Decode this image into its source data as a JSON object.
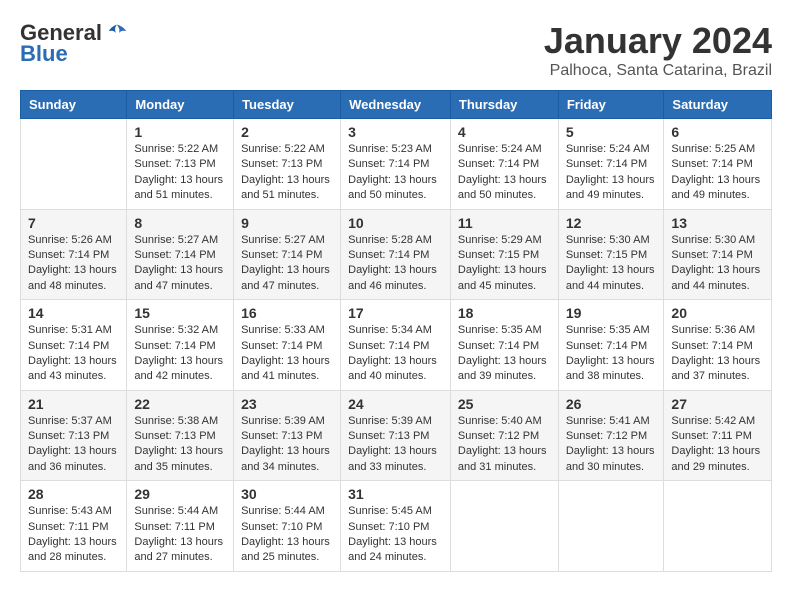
{
  "header": {
    "logo_general": "General",
    "logo_blue": "Blue",
    "month": "January 2024",
    "location": "Palhoca, Santa Catarina, Brazil"
  },
  "calendar": {
    "days_of_week": [
      "Sunday",
      "Monday",
      "Tuesday",
      "Wednesday",
      "Thursday",
      "Friday",
      "Saturday"
    ],
    "weeks": [
      [
        {
          "day": "",
          "info": ""
        },
        {
          "day": "1",
          "info": "Sunrise: 5:22 AM\nSunset: 7:13 PM\nDaylight: 13 hours\nand 51 minutes."
        },
        {
          "day": "2",
          "info": "Sunrise: 5:22 AM\nSunset: 7:13 PM\nDaylight: 13 hours\nand 51 minutes."
        },
        {
          "day": "3",
          "info": "Sunrise: 5:23 AM\nSunset: 7:14 PM\nDaylight: 13 hours\nand 50 minutes."
        },
        {
          "day": "4",
          "info": "Sunrise: 5:24 AM\nSunset: 7:14 PM\nDaylight: 13 hours\nand 50 minutes."
        },
        {
          "day": "5",
          "info": "Sunrise: 5:24 AM\nSunset: 7:14 PM\nDaylight: 13 hours\nand 49 minutes."
        },
        {
          "day": "6",
          "info": "Sunrise: 5:25 AM\nSunset: 7:14 PM\nDaylight: 13 hours\nand 49 minutes."
        }
      ],
      [
        {
          "day": "7",
          "info": "Sunrise: 5:26 AM\nSunset: 7:14 PM\nDaylight: 13 hours\nand 48 minutes."
        },
        {
          "day": "8",
          "info": "Sunrise: 5:27 AM\nSunset: 7:14 PM\nDaylight: 13 hours\nand 47 minutes."
        },
        {
          "day": "9",
          "info": "Sunrise: 5:27 AM\nSunset: 7:14 PM\nDaylight: 13 hours\nand 47 minutes."
        },
        {
          "day": "10",
          "info": "Sunrise: 5:28 AM\nSunset: 7:14 PM\nDaylight: 13 hours\nand 46 minutes."
        },
        {
          "day": "11",
          "info": "Sunrise: 5:29 AM\nSunset: 7:15 PM\nDaylight: 13 hours\nand 45 minutes."
        },
        {
          "day": "12",
          "info": "Sunrise: 5:30 AM\nSunset: 7:15 PM\nDaylight: 13 hours\nand 44 minutes."
        },
        {
          "day": "13",
          "info": "Sunrise: 5:30 AM\nSunset: 7:14 PM\nDaylight: 13 hours\nand 44 minutes."
        }
      ],
      [
        {
          "day": "14",
          "info": "Sunrise: 5:31 AM\nSunset: 7:14 PM\nDaylight: 13 hours\nand 43 minutes."
        },
        {
          "day": "15",
          "info": "Sunrise: 5:32 AM\nSunset: 7:14 PM\nDaylight: 13 hours\nand 42 minutes."
        },
        {
          "day": "16",
          "info": "Sunrise: 5:33 AM\nSunset: 7:14 PM\nDaylight: 13 hours\nand 41 minutes."
        },
        {
          "day": "17",
          "info": "Sunrise: 5:34 AM\nSunset: 7:14 PM\nDaylight: 13 hours\nand 40 minutes."
        },
        {
          "day": "18",
          "info": "Sunrise: 5:35 AM\nSunset: 7:14 PM\nDaylight: 13 hours\nand 39 minutes."
        },
        {
          "day": "19",
          "info": "Sunrise: 5:35 AM\nSunset: 7:14 PM\nDaylight: 13 hours\nand 38 minutes."
        },
        {
          "day": "20",
          "info": "Sunrise: 5:36 AM\nSunset: 7:14 PM\nDaylight: 13 hours\nand 37 minutes."
        }
      ],
      [
        {
          "day": "21",
          "info": "Sunrise: 5:37 AM\nSunset: 7:13 PM\nDaylight: 13 hours\nand 36 minutes."
        },
        {
          "day": "22",
          "info": "Sunrise: 5:38 AM\nSunset: 7:13 PM\nDaylight: 13 hours\nand 35 minutes."
        },
        {
          "day": "23",
          "info": "Sunrise: 5:39 AM\nSunset: 7:13 PM\nDaylight: 13 hours\nand 34 minutes."
        },
        {
          "day": "24",
          "info": "Sunrise: 5:39 AM\nSunset: 7:13 PM\nDaylight: 13 hours\nand 33 minutes."
        },
        {
          "day": "25",
          "info": "Sunrise: 5:40 AM\nSunset: 7:12 PM\nDaylight: 13 hours\nand 31 minutes."
        },
        {
          "day": "26",
          "info": "Sunrise: 5:41 AM\nSunset: 7:12 PM\nDaylight: 13 hours\nand 30 minutes."
        },
        {
          "day": "27",
          "info": "Sunrise: 5:42 AM\nSunset: 7:11 PM\nDaylight: 13 hours\nand 29 minutes."
        }
      ],
      [
        {
          "day": "28",
          "info": "Sunrise: 5:43 AM\nSunset: 7:11 PM\nDaylight: 13 hours\nand 28 minutes."
        },
        {
          "day": "29",
          "info": "Sunrise: 5:44 AM\nSunset: 7:11 PM\nDaylight: 13 hours\nand 27 minutes."
        },
        {
          "day": "30",
          "info": "Sunrise: 5:44 AM\nSunset: 7:10 PM\nDaylight: 13 hours\nand 25 minutes."
        },
        {
          "day": "31",
          "info": "Sunrise: 5:45 AM\nSunset: 7:10 PM\nDaylight: 13 hours\nand 24 minutes."
        },
        {
          "day": "",
          "info": ""
        },
        {
          "day": "",
          "info": ""
        },
        {
          "day": "",
          "info": ""
        }
      ]
    ]
  }
}
